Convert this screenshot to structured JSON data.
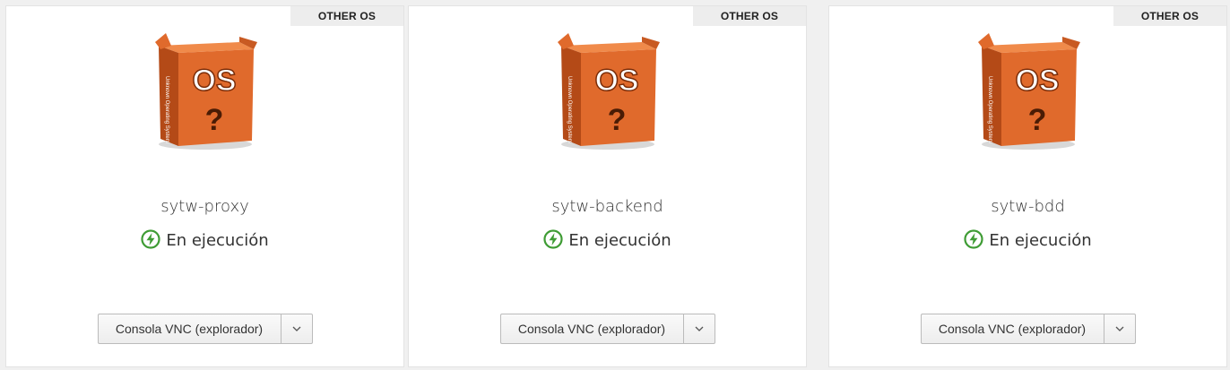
{
  "colors": {
    "status_green": "#3f9c35",
    "box_orange": "#e06a2c",
    "box_dark": "#b44a17"
  },
  "icons": {
    "os": "unknown-os-box-icon",
    "status": "power-on-icon",
    "dropdown": "chevron-down-icon"
  },
  "vms": [
    {
      "badge": "OTHER OS",
      "icon_text": "OS",
      "icon_mark": "?",
      "name": "sytw-proxy",
      "status": "En ejecución",
      "console_label": "Consola VNC (explorador)"
    },
    {
      "badge": "OTHER OS",
      "icon_text": "OS",
      "icon_mark": "?",
      "name": "sytw-backend",
      "status": "En ejecución",
      "console_label": "Consola VNC (explorador)"
    },
    {
      "badge": "OTHER OS",
      "icon_text": "OS",
      "icon_mark": "?",
      "name": "sytw-bdd",
      "status": "En ejecución",
      "console_label": "Consola VNC (explorador)"
    }
  ]
}
